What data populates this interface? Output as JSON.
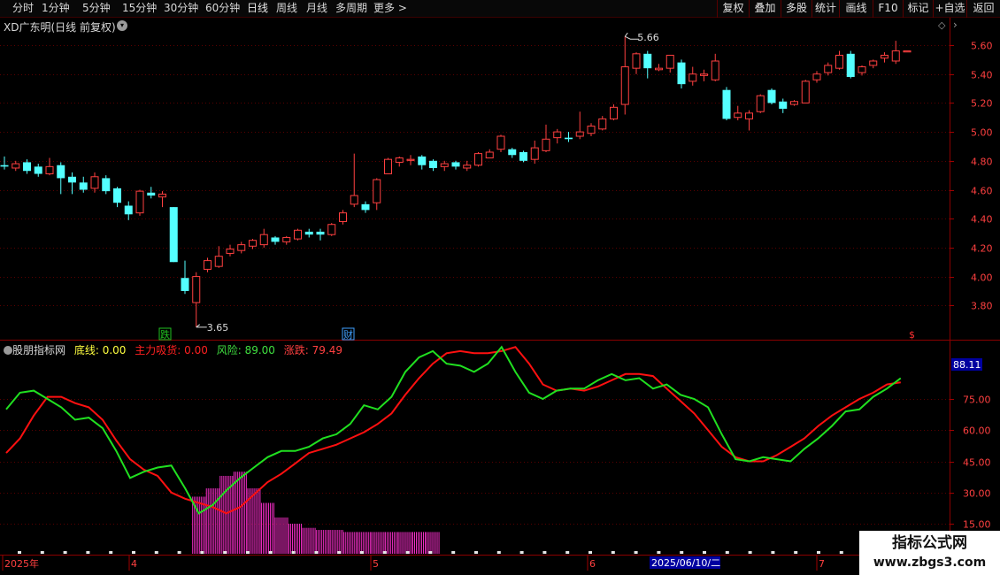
{
  "toolbar": {
    "periods": [
      "分时",
      "1分钟",
      "5分钟",
      "15分钟",
      "30分钟",
      "60分钟",
      "日线",
      "周线",
      "月线",
      "多周期",
      "更多 >"
    ],
    "active_period": "日线",
    "right_buttons": [
      "复权",
      "叠加",
      "多股",
      "统计",
      "画线",
      "F10",
      "标记",
      "+自选",
      "返回"
    ]
  },
  "main_chart": {
    "title": "XD广东明(日线 前复权)",
    "price_ticks": [
      "5.60",
      "5.40",
      "5.20",
      "5.00",
      "4.80",
      "4.60",
      "4.40",
      "4.20",
      "4.00",
      "3.80"
    ],
    "max_label": "5.66",
    "min_label": "3.65",
    "markers": [
      {
        "text": "跌",
        "color": "#20c020"
      },
      {
        "text": "财",
        "color": "#40a0ff"
      },
      {
        "text": "$",
        "color": "#ff3030"
      }
    ]
  },
  "indicator": {
    "name": "股朋指标网",
    "fields": [
      {
        "label": "底线",
        "value": "0.00",
        "color": "#ffff40"
      },
      {
        "label": "主力吸货",
        "value": "0.00",
        "color": "#ff2020"
      },
      {
        "label": "风险",
        "value": "89.00",
        "color": "#40e040"
      },
      {
        "label": "涨跌",
        "value": "79.49",
        "color": "#ff4040"
      }
    ],
    "current_value": "88.11",
    "ticks": [
      "75.00",
      "60.00",
      "45.00",
      "30.00",
      "15.00"
    ]
  },
  "date_axis": {
    "labels": [
      "2025年",
      "4",
      "5",
      "6",
      "7"
    ],
    "cursor_date": "2025/06/10/二"
  },
  "watermark": {
    "line1": "指标公式网",
    "line2": "www.zbgs3.com"
  },
  "colors": {
    "up": "#ff4040",
    "down": "#54ffff",
    "green_line": "#20e020",
    "red_line": "#ff1010",
    "magenta": "#ff30d0",
    "background": "#000000"
  },
  "chart_data": [
    {
      "type": "candlestick",
      "title": "XD广东明(日线 前复权)",
      "ylim": [
        3.6,
        5.72
      ],
      "candles": [
        [
          4.77,
          4.76,
          4.83,
          4.74
        ],
        [
          4.75,
          4.78,
          4.8,
          4.73
        ],
        [
          4.79,
          4.73,
          4.81,
          4.71
        ],
        [
          4.76,
          4.71,
          4.78,
          4.69
        ],
        [
          4.71,
          4.76,
          4.82,
          4.7
        ],
        [
          4.77,
          4.68,
          4.79,
          4.57
        ],
        [
          4.69,
          4.65,
          4.72,
          4.57
        ],
        [
          4.65,
          4.6,
          4.69,
          4.58
        ],
        [
          4.61,
          4.69,
          4.72,
          4.58
        ],
        [
          4.68,
          4.59,
          4.7,
          4.57
        ],
        [
          4.61,
          4.51,
          4.62,
          4.48
        ],
        [
          4.49,
          4.43,
          4.52,
          4.39
        ],
        [
          4.44,
          4.59,
          4.6,
          4.42
        ],
        [
          4.58,
          4.56,
          4.62,
          4.54
        ],
        [
          4.55,
          4.57,
          4.59,
          4.48
        ],
        [
          4.48,
          4.1,
          4.48,
          4.1
        ],
        [
          3.99,
          3.9,
          4.11,
          3.88
        ],
        [
          3.82,
          4.0,
          4.03,
          3.65
        ],
        [
          4.05,
          4.11,
          4.13,
          4.03
        ],
        [
          4.07,
          4.14,
          4.21,
          4.06
        ],
        [
          4.16,
          4.19,
          4.22,
          4.14
        ],
        [
          4.18,
          4.22,
          4.24,
          4.16
        ],
        [
          4.21,
          4.25,
          4.26,
          4.19
        ],
        [
          4.22,
          4.29,
          4.33,
          4.2
        ],
        [
          4.27,
          4.24,
          4.28,
          4.22
        ],
        [
          4.24,
          4.27,
          4.28,
          4.22
        ],
        [
          4.26,
          4.32,
          4.33,
          4.25
        ],
        [
          4.31,
          4.29,
          4.33,
          4.27
        ],
        [
          4.31,
          4.29,
          4.33,
          4.25
        ],
        [
          4.29,
          4.36,
          4.37,
          4.28
        ],
        [
          4.38,
          4.44,
          4.46,
          4.36
        ],
        [
          4.5,
          4.56,
          4.85,
          4.48
        ],
        [
          4.5,
          4.46,
          4.52,
          4.44
        ],
        [
          4.51,
          4.67,
          4.68,
          4.46
        ],
        [
          4.71,
          4.81,
          4.82,
          4.71
        ],
        [
          4.79,
          4.82,
          4.83,
          4.76
        ],
        [
          4.81,
          4.81,
          4.84,
          4.77
        ],
        [
          4.83,
          4.77,
          4.84,
          4.74
        ],
        [
          4.8,
          4.75,
          4.81,
          4.73
        ],
        [
          4.76,
          4.78,
          4.8,
          4.73
        ],
        [
          4.79,
          4.76,
          4.8,
          4.74
        ],
        [
          4.75,
          4.77,
          4.8,
          4.73
        ],
        [
          4.77,
          4.85,
          4.86,
          4.76
        ],
        [
          4.82,
          4.86,
          4.88,
          4.82
        ],
        [
          4.88,
          4.97,
          4.98,
          4.86
        ],
        [
          4.88,
          4.84,
          4.89,
          4.82
        ],
        [
          4.86,
          4.8,
          4.87,
          4.79
        ],
        [
          4.81,
          4.89,
          4.94,
          4.78
        ],
        [
          4.87,
          4.95,
          5.05,
          4.86
        ],
        [
          4.96,
          5.0,
          5.02,
          4.92
        ],
        [
          4.96,
          4.95,
          5.0,
          4.93
        ],
        [
          4.97,
          5.0,
          5.14,
          4.95
        ],
        [
          4.99,
          5.04,
          5.06,
          4.97
        ],
        [
          5.02,
          5.09,
          5.11,
          5.01
        ],
        [
          5.09,
          5.17,
          5.19,
          5.08
        ],
        [
          5.19,
          5.45,
          5.66,
          5.12
        ],
        [
          5.44,
          5.54,
          5.55,
          5.4
        ],
        [
          5.54,
          5.44,
          5.56,
          5.37
        ],
        [
          5.43,
          5.44,
          5.47,
          5.42
        ],
        [
          5.44,
          5.53,
          5.53,
          5.41
        ],
        [
          5.48,
          5.33,
          5.5,
          5.3
        ],
        [
          5.35,
          5.4,
          5.45,
          5.32
        ],
        [
          5.39,
          5.4,
          5.43,
          5.35
        ],
        [
          5.36,
          5.49,
          5.54,
          5.35
        ],
        [
          5.29,
          5.09,
          5.31,
          5.08
        ],
        [
          5.1,
          5.13,
          5.18,
          5.08
        ],
        [
          5.09,
          5.13,
          5.15,
          5.01
        ],
        [
          5.14,
          5.25,
          5.26,
          5.13
        ],
        [
          5.29,
          5.2,
          5.3,
          5.19
        ],
        [
          5.21,
          5.16,
          5.23,
          5.13
        ],
        [
          5.19,
          5.21,
          5.22,
          5.18
        ],
        [
          5.2,
          5.35,
          5.36,
          5.2
        ],
        [
          5.36,
          5.4,
          5.42,
          5.34
        ],
        [
          5.41,
          5.46,
          5.48,
          5.39
        ],
        [
          5.44,
          5.53,
          5.56,
          5.43
        ],
        [
          5.54,
          5.38,
          5.56,
          5.37
        ],
        [
          5.41,
          5.45,
          5.46,
          5.39
        ],
        [
          5.46,
          5.49,
          5.5,
          5.44
        ],
        [
          5.51,
          5.53,
          5.55,
          5.48
        ],
        [
          5.49,
          5.56,
          5.63,
          5.47
        ],
        [
          5.56,
          5.56,
          5.56,
          5.56
        ]
      ]
    },
    {
      "type": "line",
      "title": "股朋指标网",
      "ylim": [
        5,
        110
      ],
      "series": [
        {
          "name": "风险",
          "values": [
            70,
            78,
            79,
            75,
            71,
            65,
            66,
            61,
            50,
            37,
            40,
            42,
            43,
            32,
            20,
            24,
            31,
            37,
            42,
            47,
            50,
            50,
            52,
            56,
            58,
            63,
            72,
            70,
            76,
            88,
            95,
            98,
            92,
            91,
            88,
            92,
            100,
            88,
            78,
            75,
            79,
            80,
            80,
            84,
            87,
            84,
            85,
            80,
            82,
            77,
            75,
            71,
            58,
            46,
            45,
            47,
            46,
            45,
            51,
            56,
            62,
            69,
            70,
            76,
            80,
            85
          ]
        },
        {
          "name": "涨跌",
          "values": [
            49,
            56,
            67,
            76,
            76,
            73,
            71,
            65,
            55,
            46,
            41,
            38,
            30,
            27,
            25,
            23,
            20,
            23,
            29,
            35,
            39,
            44,
            49,
            51,
            53,
            56,
            59,
            63,
            68,
            77,
            85,
            92,
            97,
            98,
            97,
            97,
            98,
            100,
            92,
            82,
            79,
            80,
            79,
            81,
            84,
            87,
            87,
            86,
            80,
            74,
            68,
            60,
            52,
            47,
            45,
            45,
            48,
            52,
            56,
            62,
            67,
            71,
            75,
            78,
            82,
            83
          ]
        },
        {
          "name": "主力吸货",
          "values": [
            0,
            0,
            0,
            0,
            0,
            0,
            0,
            0,
            0,
            0,
            0,
            0,
            0,
            0,
            18,
            22,
            28,
            30,
            22,
            15,
            8,
            5,
            3,
            2,
            2,
            1,
            1,
            1,
            1,
            1,
            1,
            1,
            0,
            0,
            0,
            0,
            0,
            0,
            0,
            0,
            0,
            0,
            0,
            0,
            0,
            0,
            0,
            0,
            0,
            0,
            0,
            0,
            0,
            0,
            0,
            0,
            0,
            0,
            0,
            0,
            0,
            0,
            0,
            0,
            0,
            0
          ]
        }
      ]
    }
  ]
}
